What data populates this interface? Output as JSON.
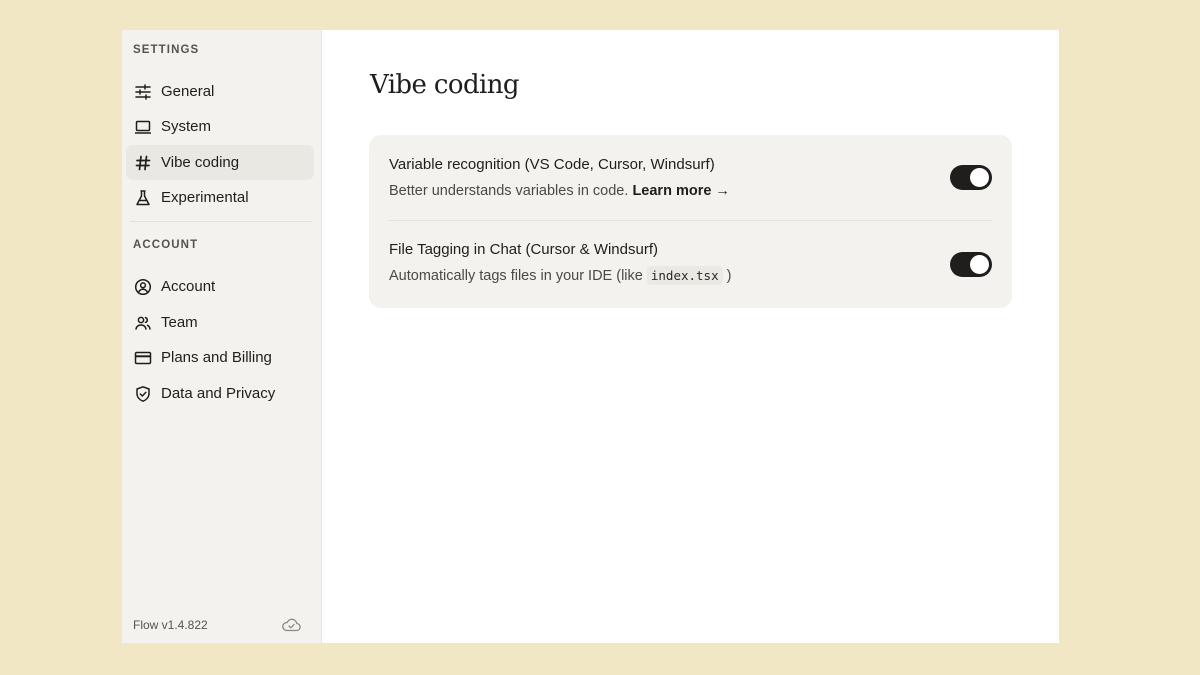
{
  "sidebar": {
    "settings_label": "SETTINGS",
    "account_label": "ACCOUNT",
    "settings_items": [
      {
        "label": "General",
        "icon": "sliders-icon"
      },
      {
        "label": "System",
        "icon": "laptop-icon"
      },
      {
        "label": "Vibe coding",
        "icon": "hash-icon",
        "active": true
      },
      {
        "label": "Experimental",
        "icon": "flask-icon"
      }
    ],
    "account_items": [
      {
        "label": "Account",
        "icon": "user-circle-icon"
      },
      {
        "label": "Team",
        "icon": "users-icon"
      },
      {
        "label": "Plans and Billing",
        "icon": "credit-card-icon"
      },
      {
        "label": "Data and Privacy",
        "icon": "shield-check-icon"
      }
    ],
    "version": "Flow v1.4.822",
    "sync_icon": "cloud-check-icon"
  },
  "main": {
    "title": "Vibe coding",
    "settings": [
      {
        "title": "Variable recognition (VS Code, Cursor, Windsurf)",
        "description": "Better understands variables in code.",
        "link_text": "Learn more →",
        "enabled": true
      },
      {
        "title": "File Tagging in Chat (Cursor & Windsurf)",
        "description_prefix": "Automatically tags files in your IDE (like",
        "code": "index.tsx",
        "description_suffix": ")",
        "enabled": true
      }
    ]
  },
  "colors": {
    "background": "#f1e7c4",
    "sidebar": "#f3f2ef",
    "toggle_on": "#1f1e1c"
  }
}
